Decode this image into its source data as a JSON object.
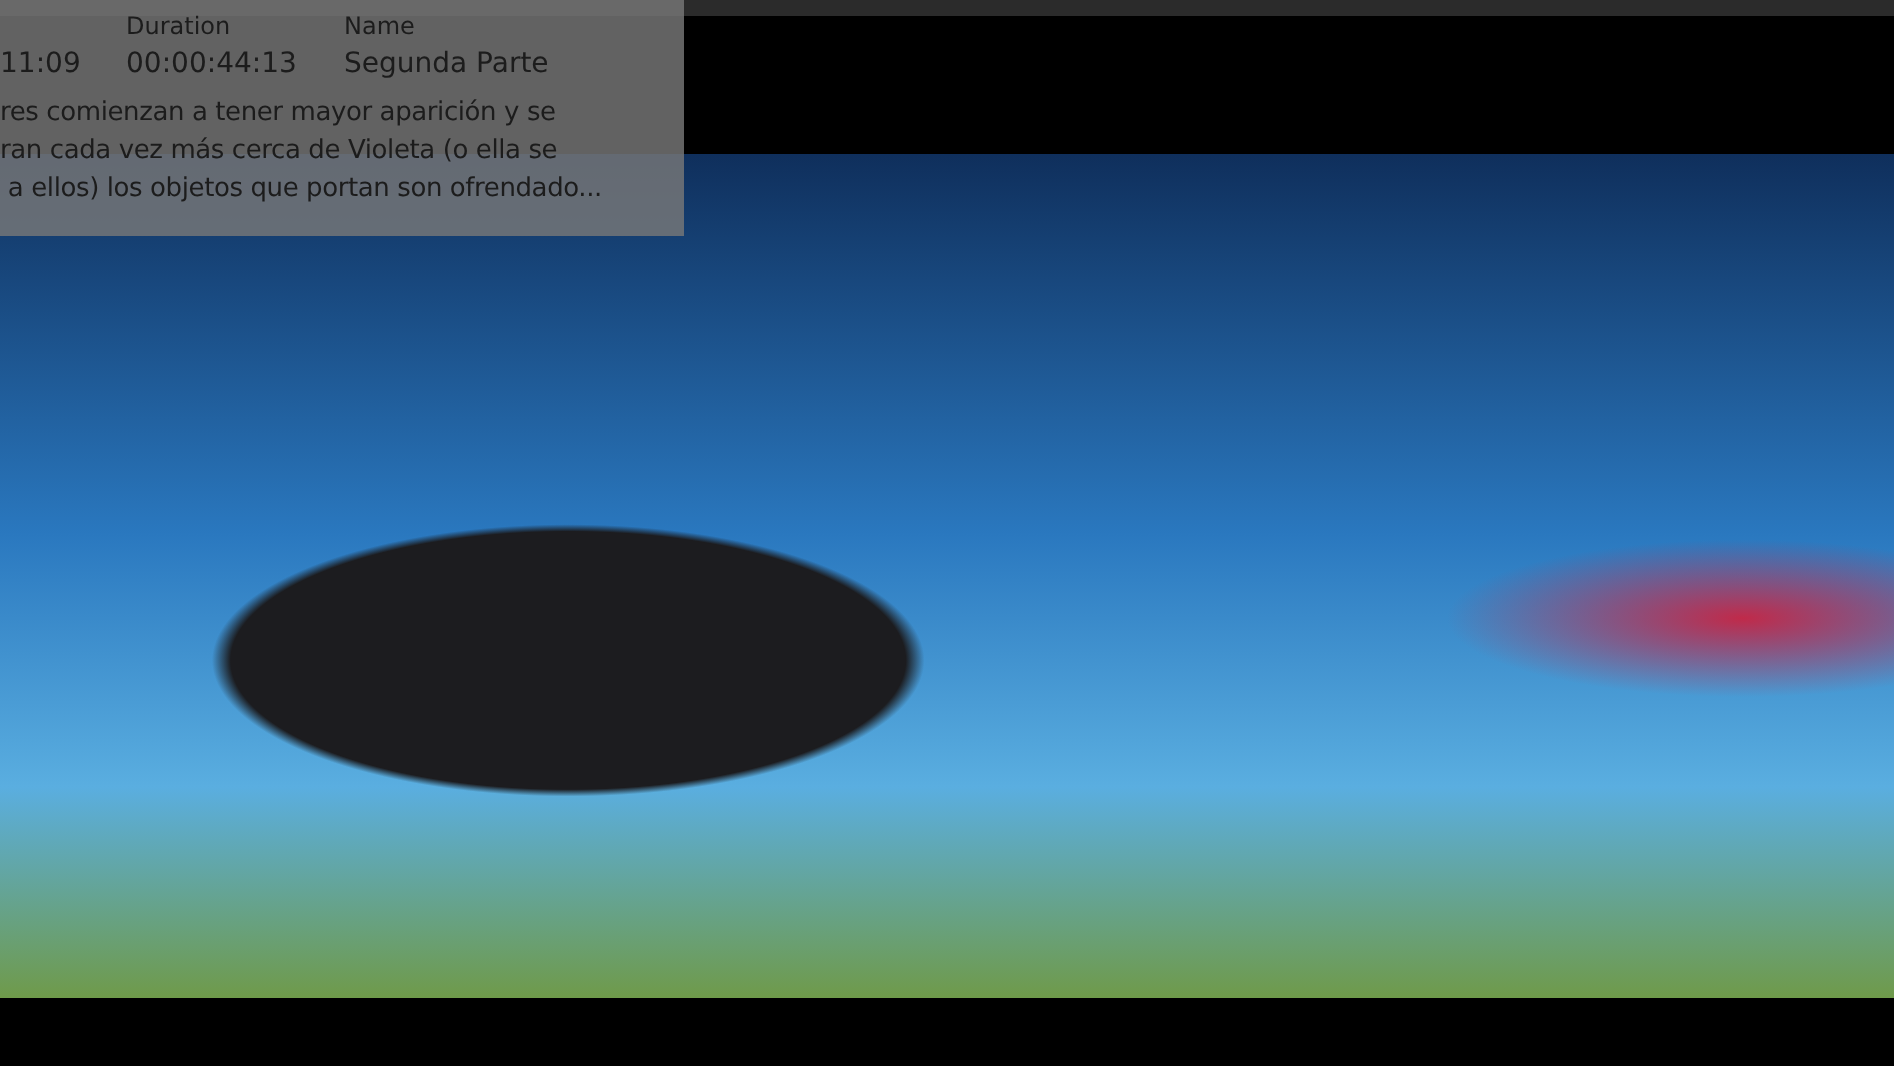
{
  "clip_info": {
    "columns": [
      {
        "value": "11:09"
      },
      {
        "header": "Duration",
        "value": "00:00:44:13"
      },
      {
        "header": "Name",
        "value": "Segunda Parte"
      }
    ],
    "description_lines": [
      "res comienzan a tener mayor aparición y se",
      "ran cada vez más cerca de Violeta (o ella se",
      " a ellos) los objetos que portan son ofrendado..."
    ]
  }
}
